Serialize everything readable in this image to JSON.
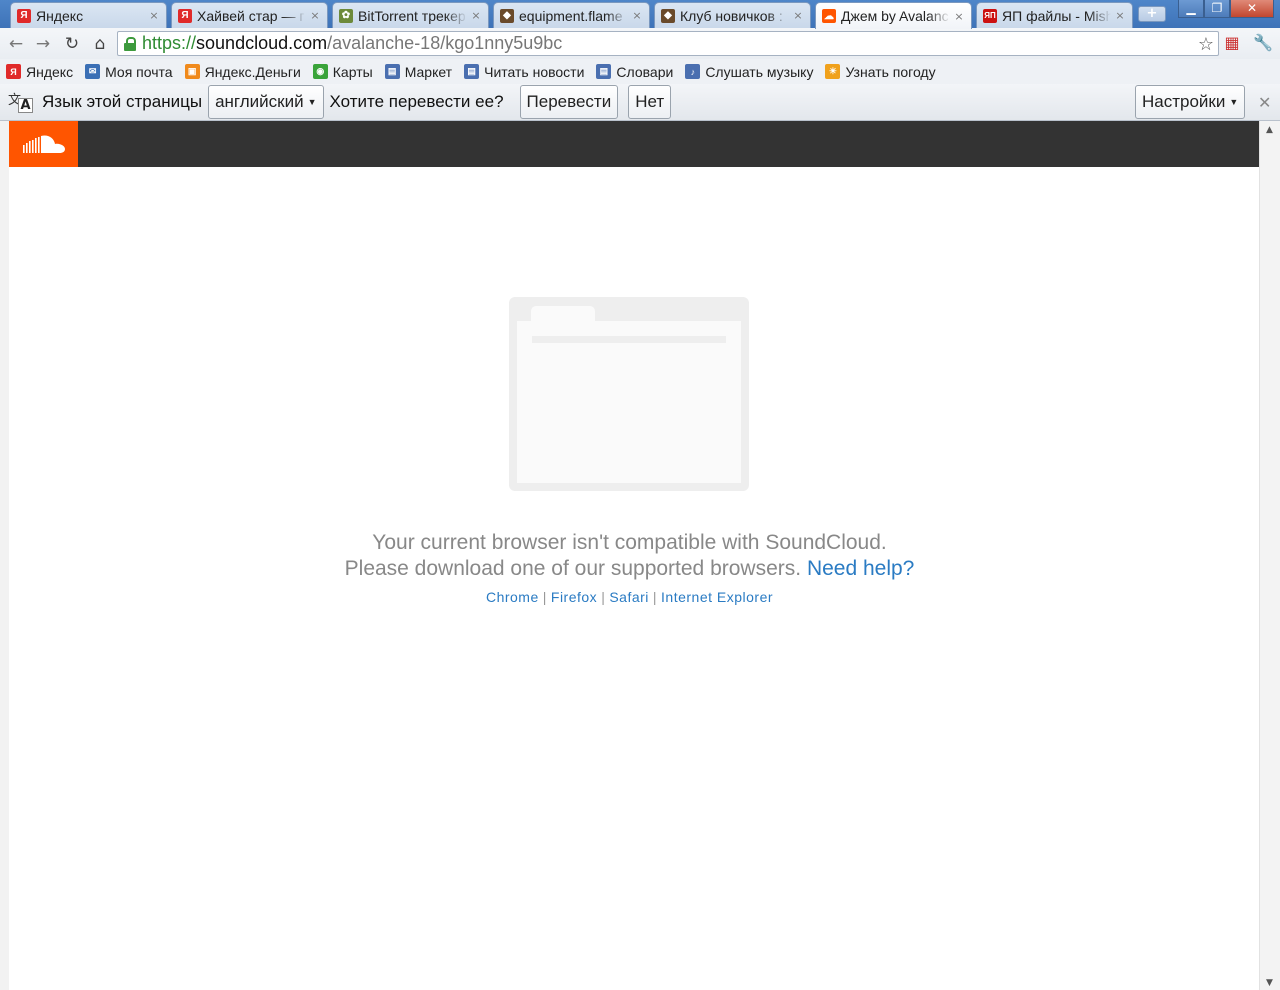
{
  "tabs": [
    {
      "label": "Яндекс",
      "favicon": "yandex-icon",
      "fav_text": "Я",
      "fav_color": "#e02a2a"
    },
    {
      "label": "Хайвей стар — г",
      "favicon": "yandex-icon",
      "fav_text": "Я",
      "fav_color": "#e02a2a"
    },
    {
      "label": "BitTorrent трекер",
      "favicon": "bittorrent-icon",
      "fav_text": "✿",
      "fav_color": "#6d8a3a"
    },
    {
      "label": "equipment.flame",
      "favicon": "forum-icon",
      "fav_text": "◆",
      "fav_color": "#6a4a2a"
    },
    {
      "label": "Клуб новичков :",
      "favicon": "forum-icon",
      "fav_text": "◆",
      "fav_color": "#6a4a2a"
    },
    {
      "label": "Джем by Avalanc",
      "favicon": "soundcloud-icon",
      "fav_text": "☁",
      "fav_color": "#ff5500",
      "active": true
    },
    {
      "label": "ЯП файлы - Mish",
      "favicon": "yap-icon",
      "fav_text": "ЯП",
      "fav_color": "#cc1111"
    }
  ],
  "address": {
    "proto": "https://",
    "host": "soundcloud.com",
    "path": "/avalanche-18/kgo1nny5u9bc"
  },
  "bookmarks": [
    {
      "label": "Яндекс",
      "icon": "yandex-icon",
      "color": "#e02a2a",
      "glyph": "Я"
    },
    {
      "label": "Моя почта",
      "icon": "mail-icon",
      "color": "#3a6fb5",
      "glyph": "✉"
    },
    {
      "label": "Яндекс.Деньги",
      "icon": "money-icon",
      "color": "#f08a1c",
      "glyph": "▣"
    },
    {
      "label": "Карты",
      "icon": "maps-icon",
      "color": "#3aa43a",
      "glyph": "◉"
    },
    {
      "label": "Маркет",
      "icon": "market-icon",
      "color": "#4a6fb0",
      "glyph": "▤"
    },
    {
      "label": "Читать новости",
      "icon": "news-icon",
      "color": "#4a6fb0",
      "glyph": "▤"
    },
    {
      "label": "Словари",
      "icon": "dictionary-icon",
      "color": "#4a6fb0",
      "glyph": "▤"
    },
    {
      "label": "Слушать музыку",
      "icon": "music-icon",
      "color": "#4a6fb0",
      "glyph": "♪"
    },
    {
      "label": "Узнать погоду",
      "icon": "weather-icon",
      "color": "#f0a11c",
      "glyph": "☀"
    }
  ],
  "translate_bar": {
    "prefix": "Язык этой страницы",
    "language": "английский",
    "question": "Хотите перевести ее?",
    "translate_button": "Перевести",
    "no_button": "Нет",
    "settings_button": "Настройки"
  },
  "page": {
    "message_line1": "Your current browser isn't compatible with SoundCloud.",
    "message_line2": "Please download one of our supported browsers.",
    "help_link": "Need help?",
    "browser_links": [
      "Chrome",
      "Firefox",
      "Safari",
      "Internet Explorer"
    ],
    "brand_color": "#ff5500",
    "header_color": "#333333",
    "link_color": "#2a7bc3"
  }
}
